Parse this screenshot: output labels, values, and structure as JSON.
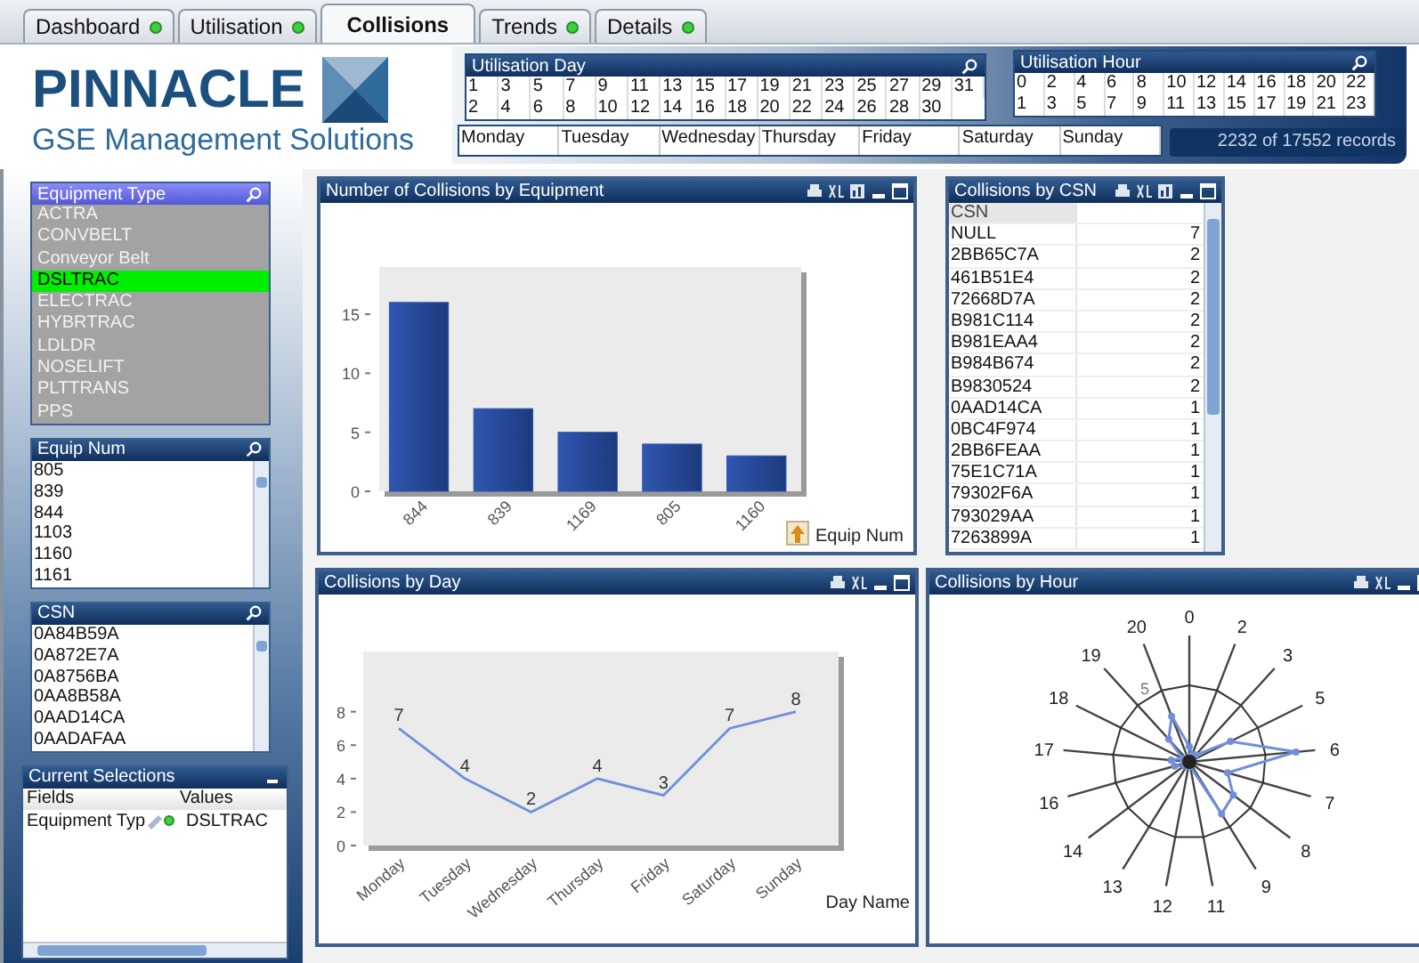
{
  "tabs": [
    {
      "label": "Dashboard",
      "selected": false,
      "indicator": true
    },
    {
      "label": "Utilisation",
      "selected": false,
      "indicator": true
    },
    {
      "label": "Collisions",
      "selected": true,
      "indicator": false
    },
    {
      "label": "Trends",
      "selected": false,
      "indicator": true
    },
    {
      "label": "Details",
      "selected": false,
      "indicator": true
    }
  ],
  "logo": {
    "name": "PINNACLE",
    "tagline": "GSE Management Solutions"
  },
  "utilisation_day": {
    "title": "Utilisation Day",
    "values": [
      "1",
      "2",
      "3",
      "4",
      "5",
      "6",
      "7",
      "8",
      "9",
      "10",
      "11",
      "12",
      "13",
      "14",
      "15",
      "16",
      "17",
      "18",
      "19",
      "20",
      "21",
      "22",
      "23",
      "24",
      "25",
      "26",
      "27",
      "28",
      "29",
      "30",
      "31"
    ]
  },
  "utilisation_hour": {
    "title": "Utilisation Hour",
    "values": [
      "0",
      "1",
      "2",
      "3",
      "4",
      "5",
      "6",
      "7",
      "8",
      "9",
      "10",
      "11",
      "12",
      "13",
      "14",
      "15",
      "16",
      "17",
      "18",
      "19",
      "20",
      "21",
      "22",
      "23"
    ]
  },
  "weekdays": [
    "Monday",
    "Tuesday",
    "Wednesday",
    "Thursday",
    "Friday",
    "Saturday",
    "Sunday"
  ],
  "record_count": "2232 of 17552 records",
  "equipment_type": {
    "title": "Equipment Type",
    "items": [
      {
        "label": "ACTRA",
        "selected": false
      },
      {
        "label": "CONVBELT",
        "selected": false
      },
      {
        "label": "Conveyor Belt",
        "selected": false
      },
      {
        "label": "DSLTRAC",
        "selected": true
      },
      {
        "label": "ELECTRAC",
        "selected": false
      },
      {
        "label": "HYBRTRAC",
        "selected": false
      },
      {
        "label": "LDLDR",
        "selected": false
      },
      {
        "label": "NOSELIFT",
        "selected": false
      },
      {
        "label": "PLTTRANS",
        "selected": false
      },
      {
        "label": "PPS",
        "selected": false
      }
    ]
  },
  "equip_num": {
    "title": "Equip Num",
    "items": [
      "805",
      "839",
      "844",
      "1103",
      "1160",
      "1161"
    ]
  },
  "csn_list": {
    "title": "CSN",
    "items": [
      "0A84B59A",
      "0A872E7A",
      "0A8756BA",
      "0AA8B58A",
      "0AAD14CA",
      "0AADAFAA"
    ]
  },
  "current_selections": {
    "title": "Current Selections",
    "columns": [
      "Fields",
      "Values"
    ],
    "rows": [
      {
        "field": "Equipment Typ",
        "value": "DSLTRAC"
      }
    ]
  },
  "bar_panel": {
    "title": "Number of Collisions by Equipment",
    "chart_data": {
      "type": "bar",
      "xlabel": "Equip Num",
      "categories": [
        "844",
        "839",
        "1169",
        "805",
        "1160"
      ],
      "values": [
        16,
        7,
        5,
        4,
        3
      ],
      "ylim": [
        0,
        19
      ],
      "yticks": [
        0,
        5,
        10,
        15
      ]
    }
  },
  "csn_table": {
    "title": "Collisions by CSN",
    "column": "CSN",
    "rows": [
      {
        "csn": "NULL",
        "count": "7"
      },
      {
        "csn": "2BB65C7A",
        "count": "2"
      },
      {
        "csn": "461B51E4",
        "count": "2"
      },
      {
        "csn": "72668D7A",
        "count": "2"
      },
      {
        "csn": "B981C114",
        "count": "2"
      },
      {
        "csn": "B981EAA4",
        "count": "2"
      },
      {
        "csn": "B984B674",
        "count": "2"
      },
      {
        "csn": "B9830524",
        "count": "2"
      },
      {
        "csn": "0AAD14CA",
        "count": "1"
      },
      {
        "csn": "0BC4F974",
        "count": "1"
      },
      {
        "csn": "2BB6FEAA",
        "count": "1"
      },
      {
        "csn": "75E1C71A",
        "count": "1"
      },
      {
        "csn": "79302F6A",
        "count": "1"
      },
      {
        "csn": "793029AA",
        "count": "1"
      },
      {
        "csn": "7263899A",
        "count": "1"
      }
    ]
  },
  "day_panel": {
    "title": "Collisions by Day",
    "chart_data": {
      "type": "line",
      "xlabel": "Day Name",
      "categories": [
        "Monday",
        "Tuesday",
        "Wednesday",
        "Thursday",
        "Friday",
        "Saturday",
        "Sunday"
      ],
      "values": [
        7,
        4,
        2,
        4,
        3,
        7,
        8
      ],
      "ylim": [
        0,
        11.6
      ],
      "yticks": [
        0,
        2,
        4,
        6,
        8
      ],
      "data_labels": true
    }
  },
  "hour_panel": {
    "title": "Collisions by Hour",
    "ring_label": "5",
    "spoke_labels": [
      "0",
      "2",
      "3",
      "5",
      "6",
      "7",
      "8",
      "9",
      "11",
      "12",
      "13",
      "14",
      "16",
      "17",
      "18",
      "19",
      "20"
    ]
  }
}
